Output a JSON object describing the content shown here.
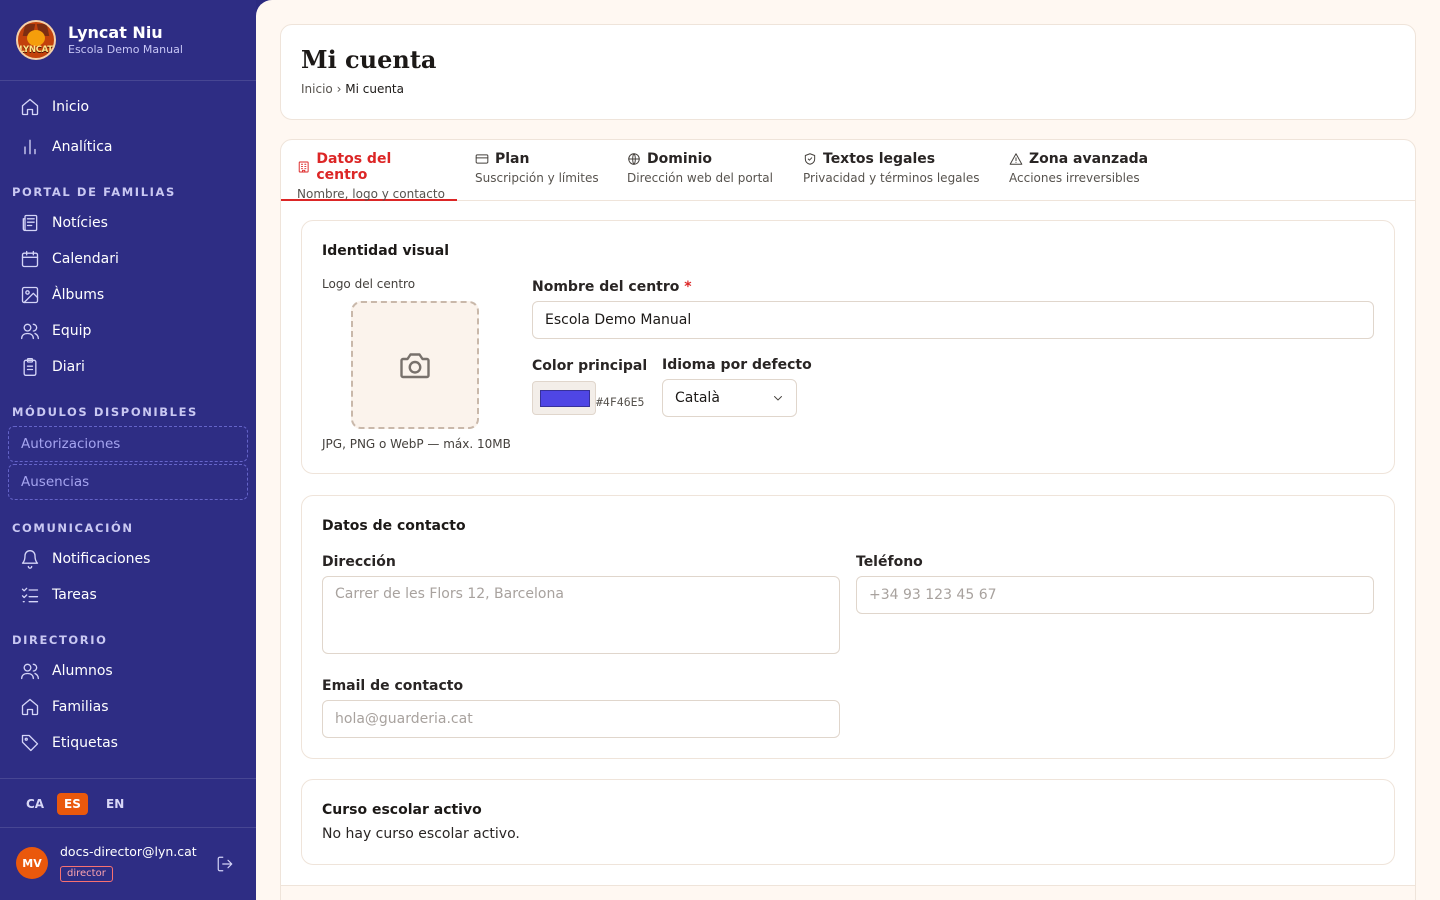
{
  "brand": {
    "title": "Lyncat Niu",
    "subtitle": "Escola Demo Manual",
    "logo_text": "LYNCAT"
  },
  "sidebar": {
    "top_items": [
      {
        "label": "Inicio",
        "icon": "home-icon"
      },
      {
        "label": "Analítica",
        "icon": "bar-chart-icon"
      }
    ],
    "sections": [
      {
        "label": "PORTAL DE FAMILIAS",
        "items": [
          {
            "label": "Notícies",
            "icon": "newspaper-icon"
          },
          {
            "label": "Calendari",
            "icon": "calendar-icon"
          },
          {
            "label": "Àlbums",
            "icon": "image-icon"
          },
          {
            "label": "Equip",
            "icon": "users-icon"
          },
          {
            "label": "Diari",
            "icon": "clipboard-icon"
          }
        ]
      },
      {
        "label": "MÓDULOS DISPONIBLES",
        "items": [
          {
            "label": "Autorizaciones"
          },
          {
            "label": "Ausencias"
          }
        ]
      },
      {
        "label": "COMUNICACIÓN",
        "items": [
          {
            "label": "Notificaciones",
            "icon": "bell-icon"
          },
          {
            "label": "Tareas",
            "icon": "list-checks-icon"
          }
        ]
      },
      {
        "label": "DIRECTORIO",
        "items": [
          {
            "label": "Alumnos",
            "icon": "users-icon"
          },
          {
            "label": "Familias",
            "icon": "home-icon"
          },
          {
            "label": "Etiquetas",
            "icon": "tag-icon"
          }
        ]
      }
    ],
    "languages": [
      "CA",
      "ES",
      "EN"
    ],
    "active_language": "ES",
    "user": {
      "initials": "MV",
      "email": "docs-director@lyn.cat",
      "role": "director"
    }
  },
  "page": {
    "title": "Mi cuenta",
    "breadcrumb": {
      "home": "Inicio",
      "separator": "›",
      "current": "Mi cuenta"
    }
  },
  "tabs": [
    {
      "label": "Datos del centro",
      "sub": "Nombre, logo y contacto",
      "icon": "building-icon",
      "active": true
    },
    {
      "label": "Plan",
      "sub": "Suscripción y límites",
      "icon": "credit-card-icon"
    },
    {
      "label": "Dominio",
      "sub": "Dirección web del portal",
      "icon": "globe-icon"
    },
    {
      "label": "Textos legales",
      "sub": "Privacidad y términos legales",
      "icon": "shield-check-icon"
    },
    {
      "label": "Zona avanzada",
      "sub": "Acciones irreversibles",
      "icon": "warning-icon"
    }
  ],
  "identity": {
    "title": "Identidad visual",
    "logo_label": "Logo del centro",
    "logo_hint": "JPG, PNG o WebP — máx. 10MB",
    "name_label": "Nombre del centro",
    "required_mark": "*",
    "name_value": "Escola Demo Manual",
    "color_label": "Color principal",
    "color_value": "#4F46E5",
    "language_label": "Idioma por defecto",
    "language_value": "Català"
  },
  "contact": {
    "title": "Datos de contacto",
    "address_label": "Dirección",
    "address_placeholder": "Carrer de les Flors 12, Barcelona",
    "phone_label": "Teléfono",
    "phone_placeholder": "+34 93 123 45 67",
    "email_label": "Email de contacto",
    "email_placeholder": "hola@guarderia.cat"
  },
  "school_year": {
    "title": "Curso escolar activo",
    "message": "No hay curso escolar activo."
  },
  "colors": {
    "sidebar": "#2e2d84",
    "accent": "#ea580c",
    "active_tab": "#dc2626",
    "brand_color": "#4F46E5"
  }
}
